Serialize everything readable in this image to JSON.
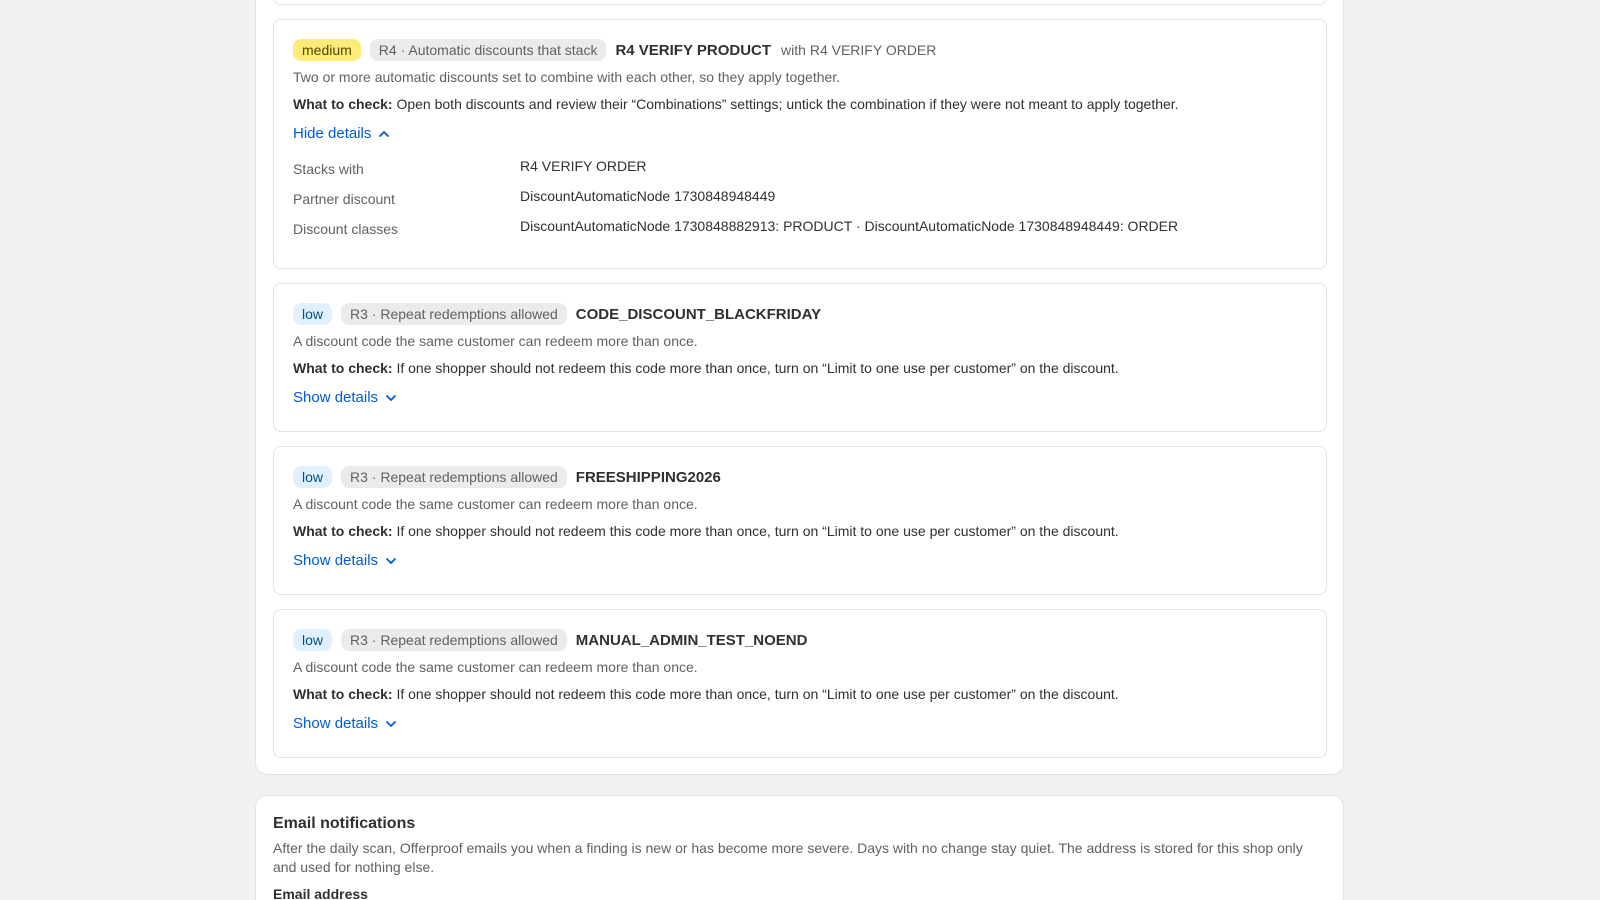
{
  "findings": [
    {
      "severity": "medium",
      "rule": "R4 · Automatic discounts that stack",
      "title": "R4 VERIFY PRODUCT",
      "with": "with R4 VERIFY ORDER",
      "description": "Two or more automatic discounts set to combine with each other, so they apply together.",
      "check_label": "What to check:",
      "check_text": " Open both discounts and review their “Combinations” settings; untick the combination if they were not meant to apply together.",
      "toggle_label": "Hide details",
      "expanded": true,
      "details": [
        {
          "key": "Stacks with",
          "value": "R4 VERIFY ORDER"
        },
        {
          "key": "Partner discount",
          "value": "DiscountAutomaticNode 1730848948449"
        },
        {
          "key": "Discount classes",
          "value": "DiscountAutomaticNode 1730848882913: PRODUCT · DiscountAutomaticNode 1730848948449: ORDER"
        }
      ]
    },
    {
      "severity": "low",
      "rule": "R3 · Repeat redemptions allowed",
      "title": "CODE_DISCOUNT_BLACKFRIDAY",
      "description": "A discount code the same customer can redeem more than once.",
      "check_label": "What to check:",
      "check_text": " If one shopper should not redeem this code more than once, turn on “Limit to one use per customer” on the discount.",
      "toggle_label": "Show details",
      "expanded": false
    },
    {
      "severity": "low",
      "rule": "R3 · Repeat redemptions allowed",
      "title": "FREESHIPPING2026",
      "description": "A discount code the same customer can redeem more than once.",
      "check_label": "What to check:",
      "check_text": " If one shopper should not redeem this code more than once, turn on “Limit to one use per customer” on the discount.",
      "toggle_label": "Show details",
      "expanded": false
    },
    {
      "severity": "low",
      "rule": "R3 · Repeat redemptions allowed",
      "title": "MANUAL_ADMIN_TEST_NOEND",
      "description": "A discount code the same customer can redeem more than once.",
      "check_label": "What to check:",
      "check_text": " If one shopper should not redeem this code more than once, turn on “Limit to one use per customer” on the discount.",
      "toggle_label": "Show details",
      "expanded": false
    }
  ],
  "email": {
    "title": "Email notifications",
    "description": "After the daily scan, Offerproof emails you when a finding is new or has become more severe. Days with no change stay quiet. The address is stored for this shop only and used for nothing else.",
    "field_label": "Email address"
  },
  "colors": {
    "medium_badge": "#ffeb78",
    "low_badge": "#e0f0ff",
    "link": "#005bd3"
  }
}
